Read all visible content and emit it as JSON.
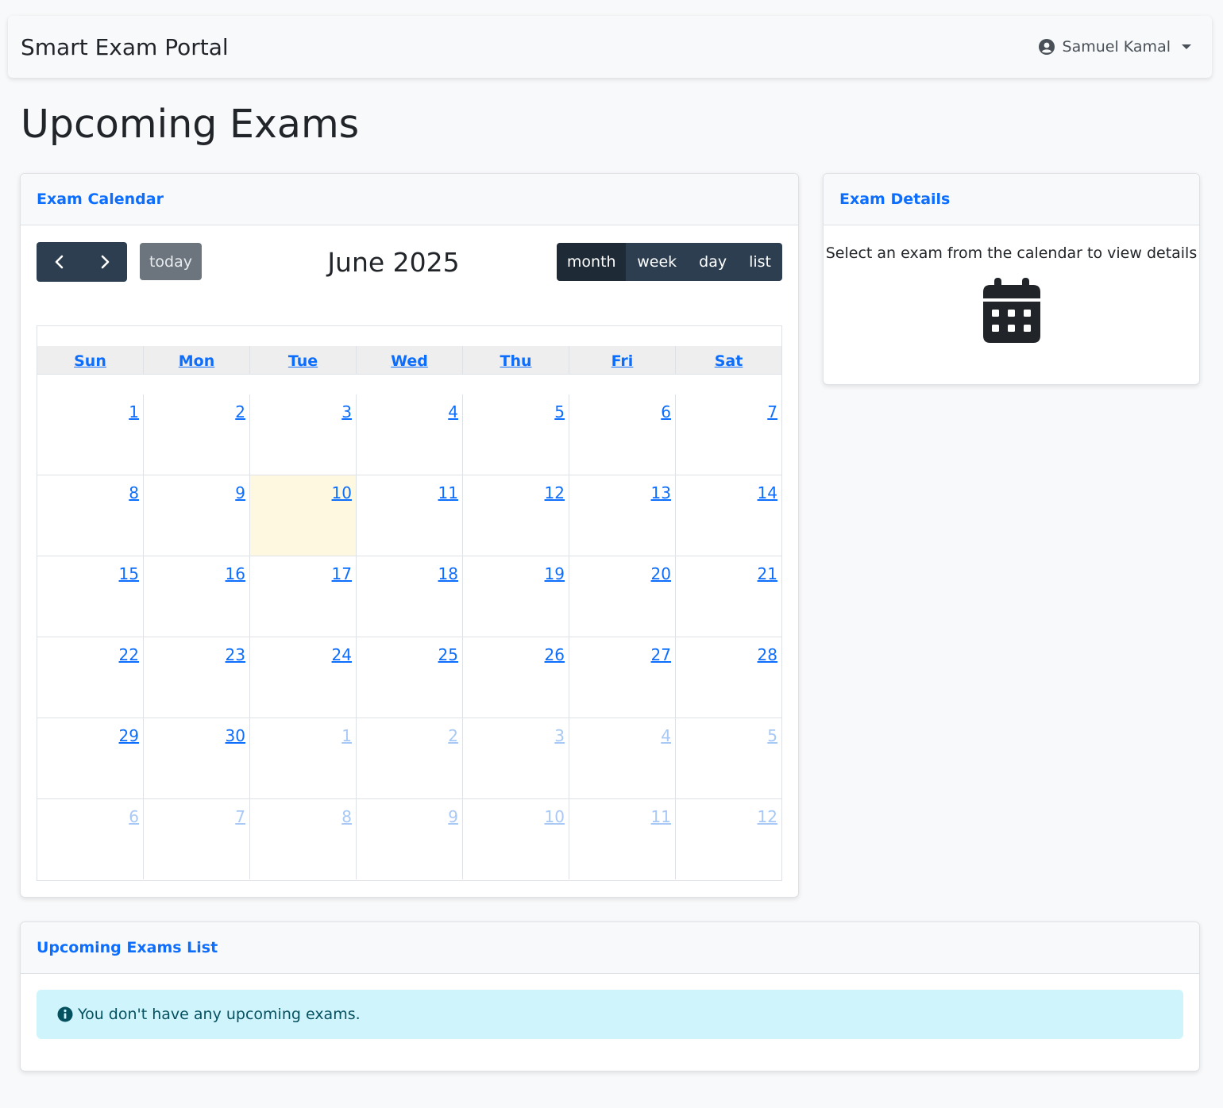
{
  "navbar": {
    "brand": "Smart Exam Portal",
    "user_name": "Samuel Kamal"
  },
  "page": {
    "title": "Upcoming Exams"
  },
  "calendar_card": {
    "header": "Exam Calendar",
    "today_label": "today",
    "month_title": "June 2025",
    "views": [
      "month",
      "week",
      "day",
      "list"
    ],
    "active_view": "month",
    "weekdays": [
      "Sun",
      "Mon",
      "Tue",
      "Wed",
      "Thu",
      "Fri",
      "Sat"
    ],
    "weeks": [
      [
        {
          "d": "1"
        },
        {
          "d": "2"
        },
        {
          "d": "3"
        },
        {
          "d": "4"
        },
        {
          "d": "5"
        },
        {
          "d": "6"
        },
        {
          "d": "7"
        }
      ],
      [
        {
          "d": "8"
        },
        {
          "d": "9"
        },
        {
          "d": "10",
          "today": true
        },
        {
          "d": "11"
        },
        {
          "d": "12"
        },
        {
          "d": "13"
        },
        {
          "d": "14"
        }
      ],
      [
        {
          "d": "15"
        },
        {
          "d": "16"
        },
        {
          "d": "17"
        },
        {
          "d": "18"
        },
        {
          "d": "19"
        },
        {
          "d": "20"
        },
        {
          "d": "21"
        }
      ],
      [
        {
          "d": "22"
        },
        {
          "d": "23"
        },
        {
          "d": "24"
        },
        {
          "d": "25"
        },
        {
          "d": "26"
        },
        {
          "d": "27"
        },
        {
          "d": "28"
        }
      ],
      [
        {
          "d": "29"
        },
        {
          "d": "30"
        },
        {
          "d": "1",
          "other": true
        },
        {
          "d": "2",
          "other": true
        },
        {
          "d": "3",
          "other": true
        },
        {
          "d": "4",
          "other": true
        },
        {
          "d": "5",
          "other": true
        }
      ],
      [
        {
          "d": "6",
          "other": true
        },
        {
          "d": "7",
          "other": true
        },
        {
          "d": "8",
          "other": true
        },
        {
          "d": "9",
          "other": true
        },
        {
          "d": "10",
          "other": true
        },
        {
          "d": "11",
          "other": true
        },
        {
          "d": "12",
          "other": true
        }
      ]
    ]
  },
  "details_card": {
    "header": "Exam Details",
    "message": "Select an exam from the calendar to view details"
  },
  "list_card": {
    "header": "Upcoming Exams List",
    "empty_message": "You don't have any upcoming exams."
  },
  "colors": {
    "accent": "#0d6efd",
    "today_bg": "#fff8e1",
    "nav_button": "#2c3e50",
    "alert_bg": "#cff4fc"
  },
  "icons": [
    "user-circle-icon",
    "caret-down-icon",
    "chevron-left-icon",
    "chevron-right-icon",
    "calendar-icon",
    "info-circle-icon"
  ]
}
